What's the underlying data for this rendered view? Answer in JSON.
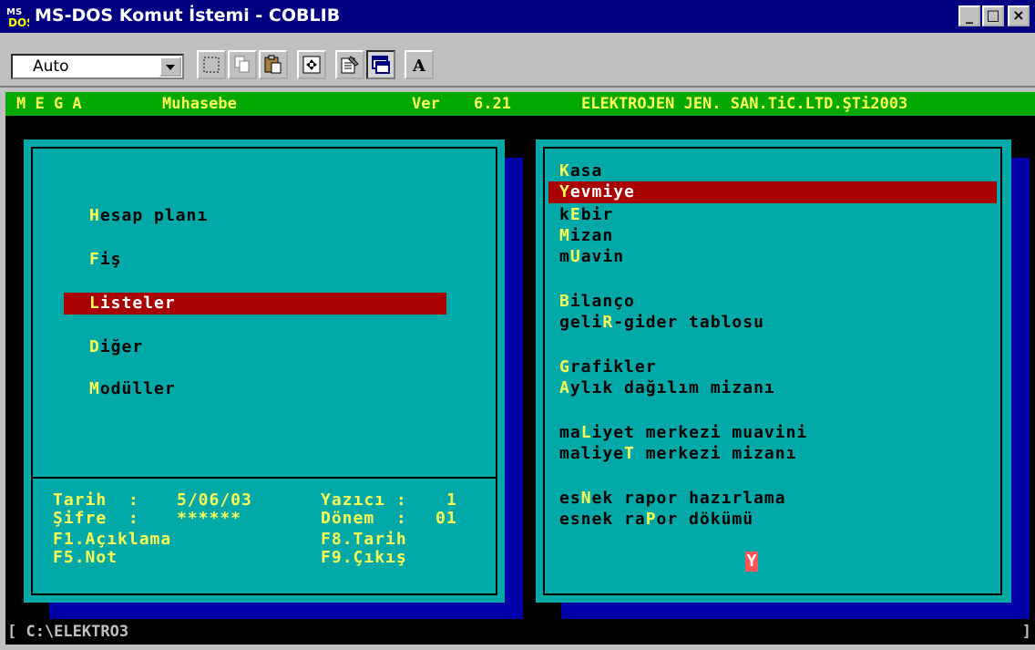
{
  "window": {
    "title": "MS-DOS Komut İstemi - COBLIB",
    "icon": "ms-dos-icon",
    "minimize": "_",
    "maximize": "□",
    "close": "×"
  },
  "toolbar": {
    "font_size_value": "Auto",
    "buttons": [
      "mark-icon",
      "copy-icon",
      "paste-icon",
      "fullscreen-icon",
      "properties-icon",
      "background-icon",
      "font-icon"
    ]
  },
  "header": {
    "brand": "M E G A",
    "module": "Muhasebe",
    "version_label": "Ver",
    "version": "6.21",
    "company": "ELEKTROJEN JEN. SAN.TiC.LTD.ŞTi2003"
  },
  "main_menu": {
    "items": [
      {
        "hotkey": "H",
        "rest": "esap planı",
        "selected": false
      },
      {
        "hotkey": "F",
        "rest": "iş",
        "selected": false
      },
      {
        "hotkey": "L",
        "rest": "isteler",
        "selected": true
      },
      {
        "hotkey": "D",
        "rest": "iğer",
        "selected": false
      },
      {
        "hotkey": "M",
        "rest": "odüller",
        "selected": false
      }
    ]
  },
  "info": {
    "date_label": "Tarih  :",
    "date_value": "5/06/03",
    "password_label": "Şifre  :",
    "password_value": "******",
    "printer_label": "Yazıcı :",
    "printer_value": "1",
    "period_label": "Dönem  :",
    "period_value": "01",
    "f1_key": "F1",
    "f1_label": ".Açıklama",
    "f5_key": "F5",
    "f5_label": ".Not",
    "f8_key": "F8",
    "f8_label": ".Tarih",
    "f9_key": "F9",
    "f9_label": ".Çıkış"
  },
  "sub_menu": {
    "items": [
      {
        "pre": "",
        "hotkey": "K",
        "post": "asa",
        "selected": false
      },
      {
        "pre": "",
        "hotkey": "Y",
        "post": "evmiye",
        "selected": true
      },
      {
        "pre": "k",
        "hotkey": "E",
        "post": "bir",
        "selected": false
      },
      {
        "pre": "",
        "hotkey": "M",
        "post": "izan",
        "selected": false
      },
      {
        "pre": "m",
        "hotkey": "U",
        "post": "avin",
        "selected": false
      },
      {
        "pre": "",
        "hotkey": "B",
        "post": "ilanço",
        "selected": false
      },
      {
        "pre": "geli",
        "hotkey": "R",
        "post": "-gider tablosu",
        "selected": false
      },
      {
        "pre": "",
        "hotkey": "G",
        "post": "rafikler",
        "selected": false
      },
      {
        "pre": "",
        "hotkey": "A",
        "post": "ylık dağılım mizanı",
        "selected": false
      },
      {
        "pre": "ma",
        "hotkey": "L",
        "post": "iyet merkezi muavini",
        "selected": false
      },
      {
        "pre": "maliye",
        "hotkey": "T",
        "post": " merkezi mizanı",
        "selected": false
      },
      {
        "pre": "es",
        "hotkey": "N",
        "post": "ek rapor hazırlama",
        "selected": false
      },
      {
        "pre": "esnek ra",
        "hotkey": "P",
        "post": "or dökümü",
        "selected": false
      }
    ],
    "input_char": "Y"
  },
  "status": {
    "path": "[ C:\\ELEKTRO3",
    "right_bracket": "]"
  },
  "colors": {
    "dos_cyan": "#00a8a8",
    "dos_blue": "#0000a8",
    "dos_green": "#00a800",
    "dos_red": "#a80000",
    "dos_yellow": "#ffff55",
    "title_blue": "#000080"
  }
}
